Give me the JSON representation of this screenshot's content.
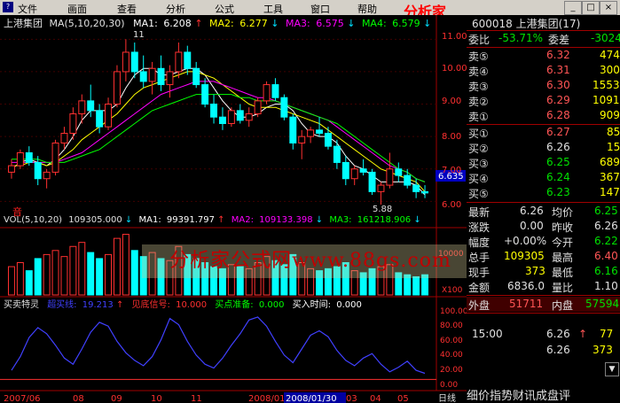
{
  "menu": {
    "items": [
      "文件",
      "画面",
      "查看",
      "分析",
      "公式",
      "工具",
      "窗口",
      "帮助"
    ],
    "icon_glyph": "?",
    "brand": "分析家"
  },
  "main_chart": {
    "title": "上港集团",
    "ma_params": "MA(5,10,20,30)",
    "ma1": {
      "label": "MA1:",
      "value": "6.208",
      "arrow": "↑",
      "color": "#ffffff"
    },
    "ma2": {
      "label": "MA2:",
      "value": "6.277",
      "arrow": "↓",
      "color": "#ffff00"
    },
    "ma3": {
      "label": "MA3:",
      "value": "6.575",
      "arrow": "↓",
      "color": "#ff00ff"
    },
    "ma4": {
      "label": "MA4:",
      "value": "6.579",
      "arrow": "↓",
      "color": "#00ff00"
    },
    "top_marker": "11",
    "low_marker": "5.88",
    "current_price_tag": "6.635",
    "axis_ticks": [
      "11.00",
      "10.00",
      "9.00",
      "8.00",
      "7.00",
      "6.00"
    ],
    "bottom_glyph": "音"
  },
  "vol_chart": {
    "params": "VOL(5,10,20)",
    "value": "109305.000",
    "value_arrow": "↓",
    "ma1": {
      "label": "MA1:",
      "value": "99391.797",
      "arrow": "↑",
      "color": "#ffffff"
    },
    "ma2": {
      "label": "MA2:",
      "value": "109133.398",
      "arrow": "↓",
      "color": "#ff00ff"
    },
    "ma3": {
      "label": "MA3:",
      "value": "161218.906",
      "arrow": "↓",
      "color": "#00ff00"
    },
    "axis_ticks": [
      "10000",
      "X100"
    ]
  },
  "ind_chart": {
    "name": "买卖特灵",
    "s1": {
      "label": "超买线:",
      "value": "19.213",
      "arrow": "↑",
      "color": "#4040ff"
    },
    "s2": {
      "label": "见底信号:",
      "value": "10.000",
      "color": "#ff3030"
    },
    "s3": {
      "label": "买点准备:",
      "value": "0.000",
      "color": "#00ff00"
    },
    "s4": {
      "label": "买入时间:",
      "value": "0.000",
      "color": "#ffffff"
    },
    "axis_ticks": [
      "100.00",
      "80.00",
      "60.00",
      "40.00",
      "20.00",
      "0.00"
    ]
  },
  "x_axis": {
    "labels": [
      "2007/06",
      "08",
      "09",
      "10",
      "11",
      "2008/01",
      "02",
      "03",
      "04",
      "05"
    ],
    "highlight": "2008/01/30",
    "period": "日线"
  },
  "quote_panel": {
    "code_name": "600018 上港集团(17)",
    "weibi_label": "委比",
    "weibi_value": "-53.71%",
    "weicha_label": "委差",
    "weicha_value": "-3024",
    "sell": [
      {
        "label": "卖⑤",
        "price": "6.32",
        "vol": "474"
      },
      {
        "label": "卖④",
        "price": "6.31",
        "vol": "300"
      },
      {
        "label": "卖③",
        "price": "6.30",
        "vol": "1553"
      },
      {
        "label": "卖②",
        "price": "6.29",
        "vol": "1091"
      },
      {
        "label": "卖①",
        "price": "6.28",
        "vol": "909"
      }
    ],
    "buy": [
      {
        "label": "买①",
        "price": "6.27",
        "vol": "85"
      },
      {
        "label": "买②",
        "price": "6.26",
        "vol": "15"
      },
      {
        "label": "买③",
        "price": "6.25",
        "vol": "689"
      },
      {
        "label": "买④",
        "price": "6.24",
        "vol": "367"
      },
      {
        "label": "买⑤",
        "price": "6.23",
        "vol": "147"
      }
    ],
    "stats": [
      {
        "l1": "最新",
        "v1": "6.26",
        "l2": "均价",
        "v2": "6.25",
        "c1": "white",
        "c2": "green"
      },
      {
        "l1": "涨跌",
        "v1": "0.00",
        "l2": "昨收",
        "v2": "6.26",
        "c1": "white",
        "c2": "white"
      },
      {
        "l1": "幅度",
        "v1": "+0.00%",
        "l2": "今开",
        "v2": "6.22",
        "c1": "white",
        "c2": "green"
      },
      {
        "l1": "总手",
        "v1": "109305",
        "l2": "最高",
        "v2": "6.40",
        "c1": "yellow",
        "c2": "red"
      },
      {
        "l1": "现手",
        "v1": "373",
        "l2": "最低",
        "v2": "6.16",
        "c1": "yellow",
        "c2": "green"
      },
      {
        "l1": "金额",
        "v1": "6836.0",
        "l2": "量比",
        "v2": "1.10",
        "c1": "white",
        "c2": "white"
      }
    ],
    "waipan_label": "外盘",
    "waipan_value": "51711",
    "neipan_label": "内盘",
    "neipan_value": "57594",
    "ticks": [
      {
        "time": "15:00",
        "price": "6.26",
        "arrow": "↑",
        "vol": "77"
      },
      {
        "time": "",
        "price": "6.26",
        "arrow": "",
        "vol": "373"
      }
    ],
    "bottom_tabs": "细价指势财讯成盘评"
  },
  "watermark": "分析家公式网www.88gs.com",
  "chart_data": {
    "type": "candlestick",
    "title": "上港集团",
    "ylim": [
      5.6,
      11.2
    ],
    "ohlc": [
      [
        6.9,
        7.3,
        6.7,
        7.1
      ],
      [
        7.1,
        7.6,
        7.0,
        7.5
      ],
      [
        7.5,
        7.7,
        7.1,
        7.2
      ],
      [
        7.2,
        7.4,
        6.5,
        6.7
      ],
      [
        6.7,
        7.0,
        6.4,
        6.9
      ],
      [
        6.9,
        7.9,
        6.8,
        7.8
      ],
      [
        7.8,
        8.3,
        7.6,
        8.1
      ],
      [
        8.1,
        8.9,
        7.9,
        8.7
      ],
      [
        8.7,
        9.3,
        8.4,
        9.1
      ],
      [
        9.1,
        9.6,
        8.6,
        8.8
      ],
      [
        8.8,
        9.0,
        8.1,
        8.3
      ],
      [
        8.3,
        9.2,
        8.2,
        9.0
      ],
      [
        9.0,
        10.2,
        8.9,
        10.0
      ],
      [
        10.0,
        11.0,
        9.7,
        10.6
      ],
      [
        10.6,
        10.9,
        9.8,
        10.0
      ],
      [
        10.0,
        10.5,
        9.5,
        9.7
      ],
      [
        9.7,
        10.3,
        9.3,
        10.1
      ],
      [
        10.1,
        10.5,
        9.4,
        9.6
      ],
      [
        9.6,
        10.2,
        9.2,
        10.0
      ],
      [
        10.0,
        10.9,
        9.8,
        10.6
      ],
      [
        10.6,
        10.8,
        9.9,
        10.1
      ],
      [
        10.1,
        10.3,
        9.5,
        9.6
      ],
      [
        9.6,
        9.8,
        8.9,
        9.0
      ],
      [
        9.0,
        9.3,
        8.4,
        8.6
      ],
      [
        8.6,
        8.9,
        8.2,
        8.4
      ],
      [
        8.4,
        8.9,
        8.3,
        8.8
      ],
      [
        8.8,
        9.0,
        8.4,
        8.5
      ],
      [
        8.5,
        8.9,
        8.3,
        8.7
      ],
      [
        8.7,
        9.2,
        8.6,
        9.1
      ],
      [
        9.1,
        9.7,
        9.0,
        9.6
      ],
      [
        9.6,
        9.8,
        9.1,
        9.2
      ],
      [
        9.2,
        9.3,
        8.5,
        8.6
      ],
      [
        8.6,
        8.7,
        7.6,
        7.8
      ],
      [
        7.8,
        8.2,
        7.3,
        8.0
      ],
      [
        8.0,
        8.3,
        7.8,
        8.2
      ],
      [
        8.2,
        8.6,
        8.0,
        8.1
      ],
      [
        8.1,
        8.3,
        7.6,
        7.7
      ],
      [
        7.7,
        7.9,
        7.0,
        7.2
      ],
      [
        7.2,
        7.4,
        6.5,
        6.7
      ],
      [
        6.7,
        7.1,
        6.5,
        7.0
      ],
      [
        7.0,
        7.3,
        6.8,
        6.9
      ],
      [
        6.9,
        7.0,
        6.2,
        6.3
      ],
      [
        6.3,
        6.6,
        5.9,
        6.5
      ],
      [
        6.5,
        7.5,
        6.4,
        7.0
      ],
      [
        7.0,
        7.2,
        6.6,
        6.8
      ],
      [
        6.8,
        7.0,
        6.4,
        6.5
      ],
      [
        6.5,
        6.7,
        6.1,
        6.3
      ],
      [
        6.3,
        6.5,
        6.1,
        6.26
      ]
    ],
    "series": [
      {
        "name": "MA1",
        "values": [
          7.0,
          7.2,
          7.3,
          7.2,
          7.1,
          7.3,
          7.6,
          8.0,
          8.5,
          8.8,
          8.8,
          8.8,
          9.0,
          9.5,
          9.9,
          10.1,
          10.1,
          9.9,
          9.9,
          10.0,
          10.1,
          10.1,
          9.9,
          9.5,
          9.1,
          8.8,
          8.6,
          8.6,
          8.7,
          8.9,
          9.0,
          9.0,
          8.8,
          8.4,
          8.1,
          8.0,
          8.0,
          7.8,
          7.4,
          7.1,
          7.0,
          6.8,
          6.6,
          6.6,
          6.6,
          6.6,
          6.5,
          6.2
        ]
      },
      {
        "name": "MA2",
        "values": [
          7.1,
          7.1,
          7.2,
          7.2,
          7.1,
          7.2,
          7.4,
          7.6,
          7.9,
          8.1,
          8.3,
          8.5,
          8.7,
          9.0,
          9.3,
          9.5,
          9.6,
          9.7,
          9.8,
          9.9,
          10.0,
          10.0,
          9.9,
          9.8,
          9.6,
          9.4,
          9.2,
          9.0,
          8.9,
          8.9,
          8.9,
          8.8,
          8.7,
          8.6,
          8.5,
          8.4,
          8.2,
          8.0,
          7.8,
          7.6,
          7.4,
          7.2,
          7.0,
          6.9,
          6.8,
          6.7,
          6.6,
          6.3
        ]
      },
      {
        "name": "MA3",
        "values": [
          7.2,
          7.2,
          7.2,
          7.2,
          7.2,
          7.2,
          7.3,
          7.4,
          7.5,
          7.7,
          7.9,
          8.1,
          8.3,
          8.5,
          8.7,
          8.9,
          9.1,
          9.3,
          9.4,
          9.5,
          9.6,
          9.7,
          9.7,
          9.7,
          9.6,
          9.5,
          9.4,
          9.3,
          9.2,
          9.2,
          9.1,
          9.0,
          8.9,
          8.8,
          8.7,
          8.6,
          8.5,
          8.3,
          8.1,
          7.9,
          7.7,
          7.5,
          7.3,
          7.1,
          7.0,
          6.9,
          6.7,
          6.6
        ]
      },
      {
        "name": "MA4",
        "values": [
          7.3,
          7.3,
          7.3,
          7.3,
          7.2,
          7.2,
          7.2,
          7.3,
          7.4,
          7.5,
          7.6,
          7.8,
          8.0,
          8.2,
          8.4,
          8.6,
          8.8,
          8.9,
          9.0,
          9.1,
          9.2,
          9.3,
          9.3,
          9.3,
          9.3,
          9.3,
          9.2,
          9.2,
          9.1,
          9.1,
          9.1,
          9.0,
          8.9,
          8.8,
          8.7,
          8.6,
          8.5,
          8.4,
          8.2,
          8.0,
          7.8,
          7.6,
          7.4,
          7.2,
          7.0,
          6.9,
          6.7,
          6.6
        ]
      }
    ],
    "volume": [
      14,
      16,
      12,
      18,
      20,
      22,
      19,
      24,
      26,
      21,
      18,
      20,
      28,
      30,
      22,
      19,
      21,
      18,
      17,
      24,
      20,
      18,
      16,
      14,
      13,
      15,
      14,
      13,
      16,
      19,
      17,
      15,
      20,
      16,
      13,
      12,
      13,
      14,
      16,
      12,
      11,
      13,
      14,
      15,
      11,
      10,
      9,
      10
    ],
    "indicator": [
      22,
      40,
      65,
      78,
      70,
      55,
      38,
      30,
      50,
      72,
      85,
      80,
      60,
      45,
      35,
      28,
      40,
      62,
      90,
      82,
      60,
      42,
      30,
      25,
      38,
      55,
      70,
      88,
      92,
      80,
      60,
      42,
      32,
      50,
      68,
      74,
      66,
      48,
      35,
      28,
      38,
      44,
      30,
      20,
      26,
      34,
      22,
      18
    ]
  }
}
